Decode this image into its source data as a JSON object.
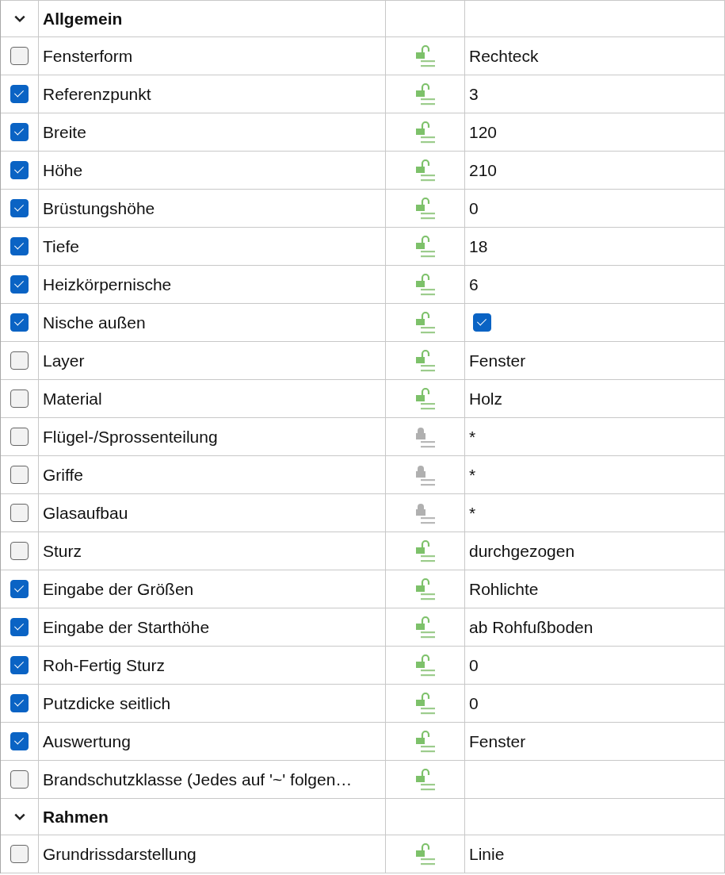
{
  "sections": [
    {
      "title": "Allgemein",
      "expanded": true,
      "rows": [
        {
          "kind": "text",
          "name": "Fensterform",
          "checked": false,
          "locked": false,
          "value": "Rechteck"
        },
        {
          "kind": "text",
          "name": "Referenzpunkt",
          "checked": true,
          "locked": false,
          "value": "3"
        },
        {
          "kind": "text",
          "name": "Breite",
          "checked": true,
          "locked": false,
          "value": "120"
        },
        {
          "kind": "text",
          "name": "Höhe",
          "checked": true,
          "locked": false,
          "value": "210"
        },
        {
          "kind": "text",
          "name": "Brüstungshöhe",
          "checked": true,
          "locked": false,
          "value": "0"
        },
        {
          "kind": "text",
          "name": "Tiefe",
          "checked": true,
          "locked": false,
          "value": "18"
        },
        {
          "kind": "text",
          "name": "Heizkörpernische",
          "checked": true,
          "locked": false,
          "value": "6"
        },
        {
          "kind": "checkbox",
          "name": "Nische außen",
          "checked": true,
          "locked": false,
          "value_checked": true
        },
        {
          "kind": "text",
          "name": "Layer",
          "checked": false,
          "locked": false,
          "value": "Fenster"
        },
        {
          "kind": "text",
          "name": "Material",
          "checked": false,
          "locked": false,
          "value": "Holz"
        },
        {
          "kind": "text",
          "name": "Flügel-/Sprossenteilung",
          "checked": false,
          "locked": true,
          "value": "*"
        },
        {
          "kind": "text",
          "name": "Griffe",
          "checked": false,
          "locked": true,
          "value": "*"
        },
        {
          "kind": "text",
          "name": "Glasaufbau",
          "checked": false,
          "locked": true,
          "value": "*"
        },
        {
          "kind": "text",
          "name": "Sturz",
          "checked": false,
          "locked": false,
          "value": "durchgezogen"
        },
        {
          "kind": "text",
          "name": "Eingabe der Größen",
          "checked": true,
          "locked": false,
          "value": "Rohlichte"
        },
        {
          "kind": "text",
          "name": "Eingabe der Starthöhe",
          "checked": true,
          "locked": false,
          "value": "ab Rohfußboden"
        },
        {
          "kind": "text",
          "name": "Roh-Fertig Sturz",
          "checked": true,
          "locked": false,
          "value": "0"
        },
        {
          "kind": "text",
          "name": "Putzdicke seitlich",
          "checked": true,
          "locked": false,
          "value": "0"
        },
        {
          "kind": "text",
          "name": "Auswertung",
          "checked": true,
          "locked": false,
          "value": "Fenster"
        },
        {
          "kind": "text",
          "name": "Brandschutzklasse (Jedes auf '~' folgen…",
          "checked": false,
          "locked": false
        }
      ]
    },
    {
      "title": "Rahmen",
      "expanded": true,
      "rows": [
        {
          "kind": "text",
          "name": "Grundrissdarstellung",
          "checked": false,
          "locked": false,
          "value": "Linie"
        }
      ]
    }
  ]
}
